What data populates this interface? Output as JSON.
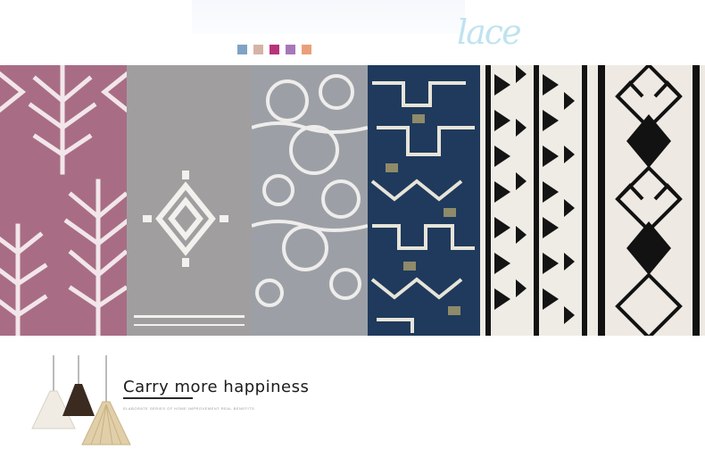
{
  "brand": {
    "logo_text": "lace"
  },
  "swatches": {
    "colors": [
      "#7fa3c4",
      "#d4b4a6",
      "#b8337a",
      "#a678b8",
      "#e9a07a"
    ]
  },
  "rugs": {
    "items": [
      {
        "name": "rose-tree-pattern",
        "base": "#a86d84",
        "ink": "#f2e6ea"
      },
      {
        "name": "grey-diamond-pattern",
        "base": "#a19ea0",
        "ink": "#f3f1ee"
      },
      {
        "name": "grey-lace-pattern",
        "base": "#8f939a",
        "ink": "#ecebea"
      },
      {
        "name": "navy-olive-geometric",
        "base": "#1f3a5c",
        "ink": "#e7e4d9",
        "accent": "#8e8a6a"
      },
      {
        "name": "black-triangle-stripes",
        "base": "#efece6",
        "ink": "#141414"
      },
      {
        "name": "black-diamond-lattice",
        "base": "#eeeae3",
        "ink": "#121212"
      }
    ]
  },
  "banner": {
    "headline": "Carry more happiness",
    "subline": "ELABORATE SERIES OF HOME IMPROVEMENT REAL BENEFITS"
  },
  "lamps": {
    "items": [
      {
        "name": "white-lamp",
        "color": "#f0ece4"
      },
      {
        "name": "dark-brown-lamp",
        "color": "#3a2a20"
      },
      {
        "name": "wood-lamp",
        "color": "#e0cfa8"
      }
    ]
  }
}
